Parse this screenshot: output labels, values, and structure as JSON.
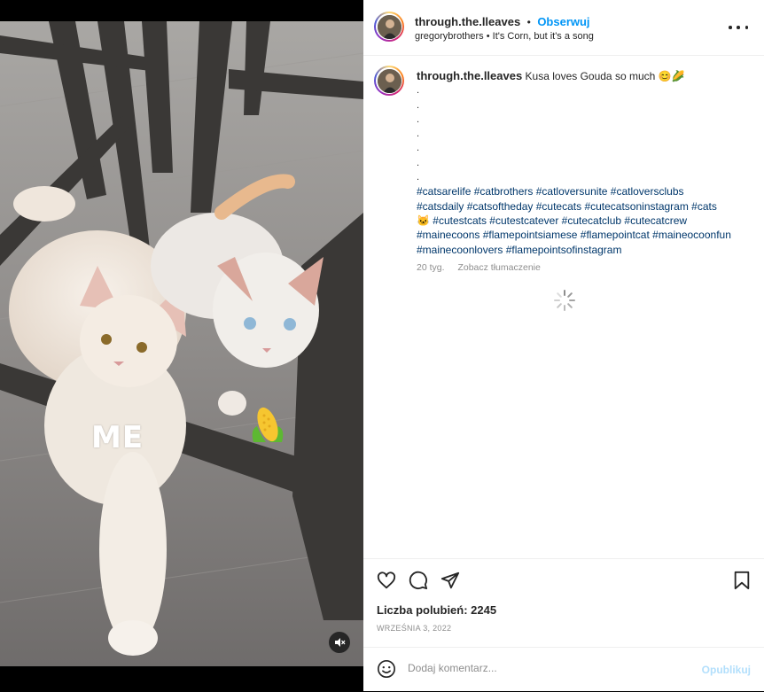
{
  "post": {
    "author": "through.the.lleaves",
    "separator": "•",
    "follow_label": "Obserwuj",
    "audio_artist": "gregorybrothers",
    "audio_title": "It's Corn, but it's a song",
    "media_overlay_text": "ME"
  },
  "caption": {
    "author": "through.the.lleaves",
    "text": "Kusa loves Gouda so much 😊🌽",
    "dots": [
      ".",
      ".",
      ".",
      ".",
      ".",
      ".",
      "."
    ],
    "hashtag_lines": [
      "#catsarelife #catbrothers #catloversunite #catloversclubs",
      "#catsdaily #catsoftheday #cutecats #cutecatsoninstagram #cats",
      "🐱 #cutestcats #cutestcatever #cutecatclub #cutecatcrew",
      "#mainecoons #flamepointsiamese #flamepointcat #maineocoonfun",
      "#mainecoonlovers #flamepointsofinstagram"
    ],
    "age": "20 tyg.",
    "translate_label": "Zobacz tłumaczenie"
  },
  "stats": {
    "likes_label": "Liczba polubień: 2245",
    "date": "WRZEŚNIA 3, 2022"
  },
  "comment": {
    "placeholder": "Dodaj komentarz...",
    "publish_label": "Opublikuj"
  },
  "icons": {
    "like": "heart-icon",
    "comment": "comment-icon",
    "share": "send-icon",
    "save": "bookmark-icon",
    "emoji": "emoji-icon",
    "mute": "mute-icon",
    "more": "more-options-icon"
  },
  "colors": {
    "link": "#0095f6",
    "hashtag": "#00376b",
    "muted": "#8e8e8e",
    "publish_disabled": "#b2dffc"
  }
}
